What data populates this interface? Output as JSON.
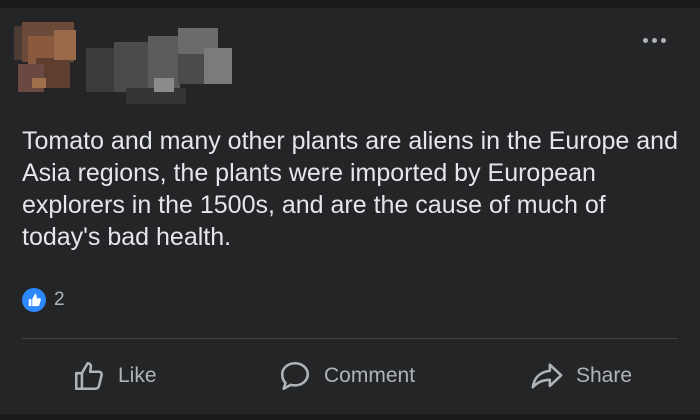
{
  "post": {
    "text": "Tomato and many other plants are aliens in the Europe and Asia regions, the plants were imported by European explorers in the 1500s, and are the cause of much of today's bad health.",
    "reactions": {
      "icon": "like-icon",
      "count": "2"
    }
  },
  "actions": {
    "like_label": "Like",
    "comment_label": "Comment",
    "share_label": "Share"
  },
  "colors": {
    "background": "#242526",
    "text": "#e4e6eb",
    "secondary_text": "#b0b3b8",
    "like_blue": "#2d88ff",
    "divider": "#3e4042"
  }
}
